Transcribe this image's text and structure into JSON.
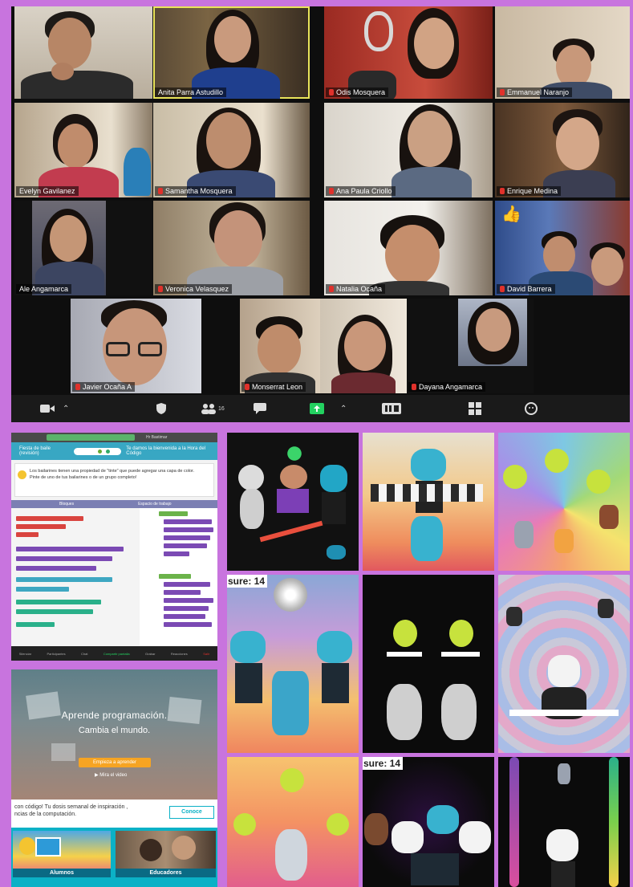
{
  "meeting": {
    "participants": [
      {
        "name": "",
        "muted": false
      },
      {
        "name": "Anita Parra Astudillo",
        "muted": false
      },
      {
        "name": "Odis Mosquera",
        "muted": true
      },
      {
        "name": "Emmanuel Naranjo",
        "muted": true
      },
      {
        "name": "Evelyn Gavilanez",
        "muted": false
      },
      {
        "name": "Samantha Mosquera",
        "muted": true
      },
      {
        "name": "Ana Paula Criollo",
        "muted": true
      },
      {
        "name": "Enrique Medina",
        "muted": true
      },
      {
        "name": "Ale Angamarca",
        "muted": false
      },
      {
        "name": "Veronica Velasquez",
        "muted": true
      },
      {
        "name": "Natalia Ocaña",
        "muted": true
      },
      {
        "name": "David Barrera",
        "muted": true
      },
      {
        "name": "Javier Ocaña A",
        "muted": true
      },
      {
        "name": "Monserrat Leon",
        "muted": true
      },
      {
        "name": "",
        "muted": false
      },
      {
        "name": "Dayana Angamarca",
        "muted": true
      }
    ],
    "reaction_icon": "thumbs-up-icon",
    "toolbar": {
      "participants_count": "16",
      "icons": [
        "video-icon",
        "chevron-up-icon",
        "security-icon",
        "participants-icon",
        "chat-icon",
        "share-screen-icon",
        "record-icon",
        "breakout-rooms-icon",
        "reactions-icon"
      ]
    }
  },
  "lesson": {
    "tab_title": "Hr Bastimar",
    "header_title": "Fiesta de baile (revisión)",
    "header_level": "Te damos la bienvenida a la Hora del Código",
    "instructions": [
      "Los bailarines tienen una propiedad de \"tinte\" que puede agregar una capa de color.",
      "Pinte de uno de tus bailarines o de un grupo completo!"
    ],
    "workspace_labels": [
      "Bloques",
      "Espacio de trabajo"
    ],
    "zoombar": [
      "Silenciar",
      "Participantes",
      "Chat",
      "Compartir pantalla",
      "Grabar",
      "Reacciones",
      "Salir"
    ]
  },
  "landing": {
    "headline": "Aprende programación.",
    "subheadline": "Cambia el mundo.",
    "cta": "Empieza a aprender",
    "video_link": "Mira el video",
    "promo_lines": [
      "con código! Tu dosis semanal de inspiración ,",
      "ncias de la computación."
    ],
    "promo_button": "Conoce",
    "cards": [
      "Alumnos",
      "Educadores"
    ]
  },
  "dance_party": {
    "score_label": "sure: 14",
    "score_label_2": "sure: 14"
  },
  "colors": {
    "frame": "#c874de",
    "codeorg_teal": "#0bb1c6",
    "zoom_green": "#23d160",
    "mute_red": "#e0312b"
  }
}
